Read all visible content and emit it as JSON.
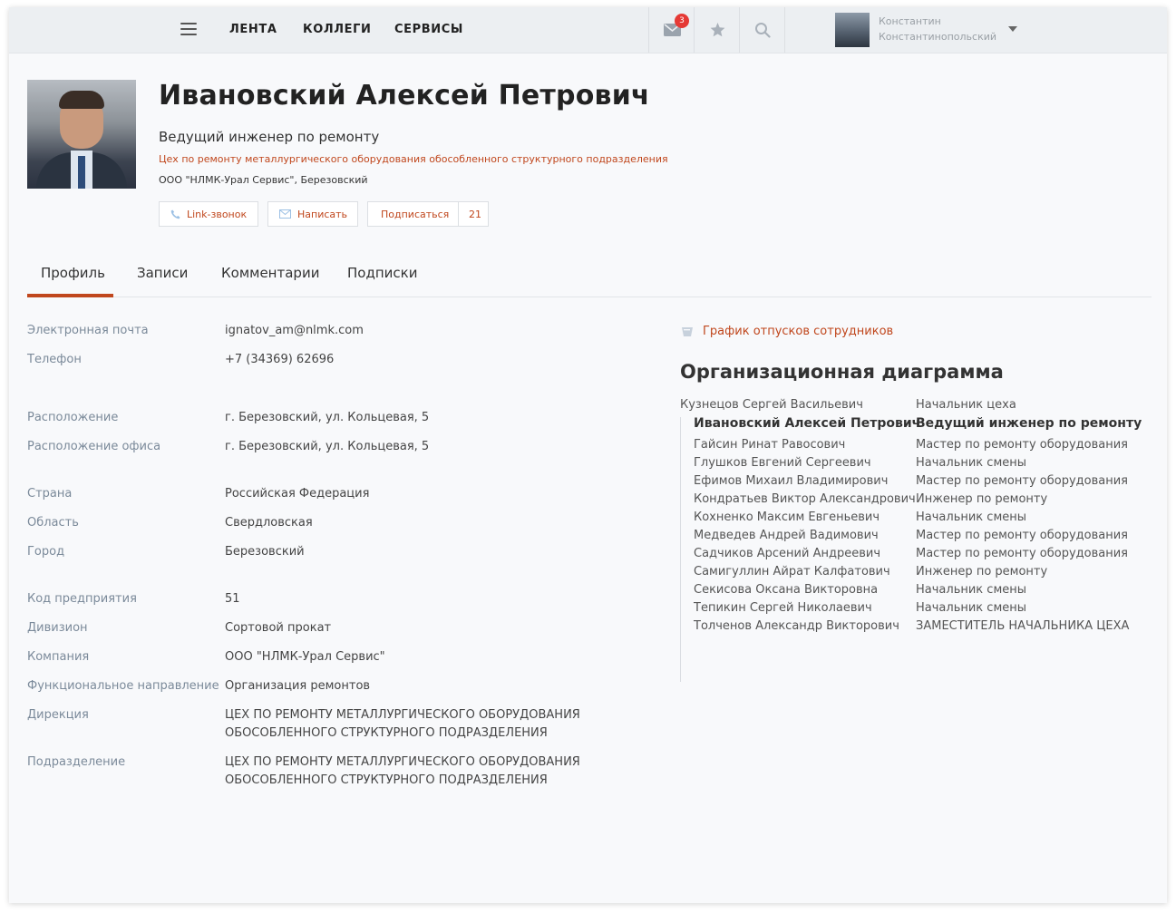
{
  "topbar": {
    "nav": [
      "ЛЕНТА",
      "КОЛЛЕГИ",
      "СЕРВИСЫ"
    ],
    "mail_badge": "3",
    "user_first": "Константин",
    "user_last": "Константинопольский",
    "icons": [
      "menu-icon",
      "mail-icon",
      "star-icon",
      "search-icon",
      "chevron-down-icon"
    ]
  },
  "profile": {
    "name": "Ивановский Алексей Петрович",
    "position": "Ведущий инженер по ремонту",
    "department": "Цех по ремонту металлургического оборудования обособленного структурного подразделения",
    "company": "ООО \"НЛМК-Урал Сервис\", Березовский",
    "buttons": {
      "call": "Link-звонок",
      "write": "Написать",
      "subscribe": "Подписаться",
      "subscribers": "21"
    }
  },
  "tabs": [
    "Профиль",
    "Записи",
    "Комментарии",
    "Подписки"
  ],
  "details": [
    {
      "label": "Электронная почта",
      "value": "ignatov_am@nlmk.com"
    },
    {
      "label": "Телефон",
      "value": "+7 (34369) 62696"
    },
    {
      "label": "Расположение",
      "value": "г. Березовский, ул. Кольцевая, 5"
    },
    {
      "label": "Расположение офиса",
      "value": "г. Березовский, ул. Кольцевая, 5"
    },
    {
      "label": "Страна",
      "value": "Российская Федерация"
    },
    {
      "label": "Область",
      "value": "Свердловская"
    },
    {
      "label": "Город",
      "value": "Березовский"
    },
    {
      "label": "Код предприятия",
      "value": "51"
    },
    {
      "label": "Дивизион",
      "value": "Сортовой прокат"
    },
    {
      "label": "Компания",
      "value": "ООО \"НЛМК-Урал Сервис\""
    },
    {
      "label": "Функциональное направление",
      "value": "Организация ремонтов"
    },
    {
      "label": "Дирекция",
      "value": "ЦЕХ ПО РЕМОНТУ МЕТАЛЛУРГИЧЕСКОГО ОБОРУДОВАНИЯ",
      "value2": "ОБОСОБЛЕННОГО СТРУКТУРНОГО ПОДРАЗДЕЛЕНИЯ"
    },
    {
      "label": "Подразделение",
      "value": "ЦЕХ ПО РЕМОНТУ МЕТАЛЛУРГИЧЕСКОГО ОБОРУДОВАНИЯ",
      "value2": "ОБОСОБЛЕННОГО СТРУКТУРНОГО ПОДРАЗДЕЛЕНИЯ"
    }
  ],
  "vacation_link": "График отпусков сотрудников",
  "org": {
    "title": "Организационная диаграмма",
    "manager": {
      "name": "Кузнецов Сергей Васильевич",
      "role": "Начальник цеха"
    },
    "current": {
      "name": "Ивановский Алексей Петрович",
      "role": "Ведущий инженер по ремонту"
    },
    "reports": [
      {
        "name": "Гайсин Ринат Равосович",
        "role": "Мастер по ремонту оборудования"
      },
      {
        "name": "Глушков Евгений Сергеевич",
        "role": "Начальник смены"
      },
      {
        "name": "Ефимов Михаил Владимирович",
        "role": "Мастер по ремонту оборудования"
      },
      {
        "name": "Кондратьев Виктор Александрович",
        "role": "Инженер по ремонту"
      },
      {
        "name": "Кохненко Максим Евгеньевич",
        "role": "Начальник смены"
      },
      {
        "name": "Медведев Андрей Вадимович",
        "role": "Мастер по ремонту оборудования"
      },
      {
        "name": "Садчиков Арсений Андреевич",
        "role": "Мастер по ремонту оборудования"
      },
      {
        "name": "Самигуллин Айрат Калфатович",
        "role": "Инженер по ремонту"
      },
      {
        "name": "Секисова Оксана Викторовна",
        "role": "Начальник смены"
      },
      {
        "name": "Тепикин Сергей Николаевич",
        "role": "Начальник смены"
      },
      {
        "name": "Толченов Александр Викторович",
        "role": "ЗАМЕСТИТЕЛЬ НАЧАЛЬНИКА ЦЕХА"
      }
    ]
  },
  "colors": {
    "accent": "#c0471d",
    "label": "#7b8a9a",
    "badge": "#e53935"
  }
}
